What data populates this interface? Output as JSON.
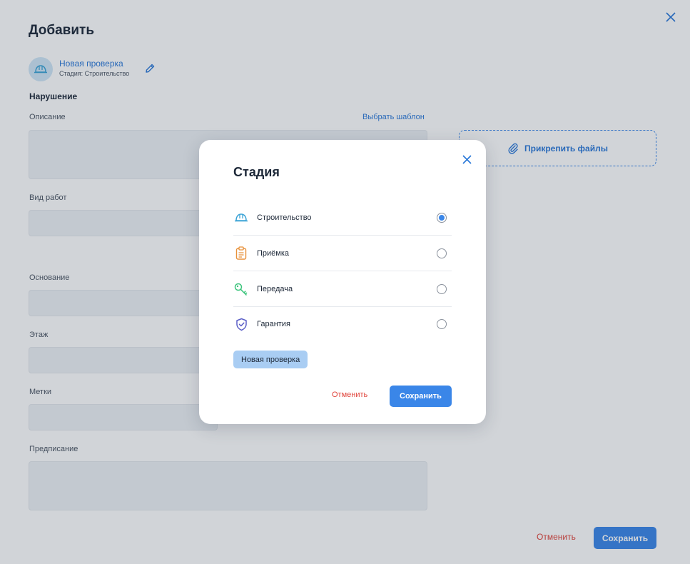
{
  "page": {
    "title": "Добавить",
    "check": {
      "name": "Новая проверка",
      "stage": "Стадия: Строительство"
    },
    "section": "Нарушение",
    "fields": {
      "description": "Описание",
      "template_link": "Выбрать шаблон",
      "work_type": "Вид работ",
      "basis": "Основание",
      "floor": "Этаж",
      "tags": "Метки",
      "prescription": "Предписание"
    },
    "attach": "Прикрепить файлы",
    "cancel": "Отменить",
    "save": "Сохранить"
  },
  "modal": {
    "title": "Стадия",
    "options": [
      {
        "label": "Строительство",
        "icon": "helmet-icon",
        "selected": true
      },
      {
        "label": "Приёмка",
        "icon": "clipboard-icon",
        "selected": false
      },
      {
        "label": "Передача",
        "icon": "key-icon",
        "selected": false
      },
      {
        "label": "Гарантия",
        "icon": "shield-check-icon",
        "selected": false
      }
    ],
    "chip": "Новая проверка",
    "cancel": "Отменить",
    "save": "Сохранить"
  },
  "colors": {
    "accent": "#3a86e8",
    "danger": "#e0443b"
  }
}
